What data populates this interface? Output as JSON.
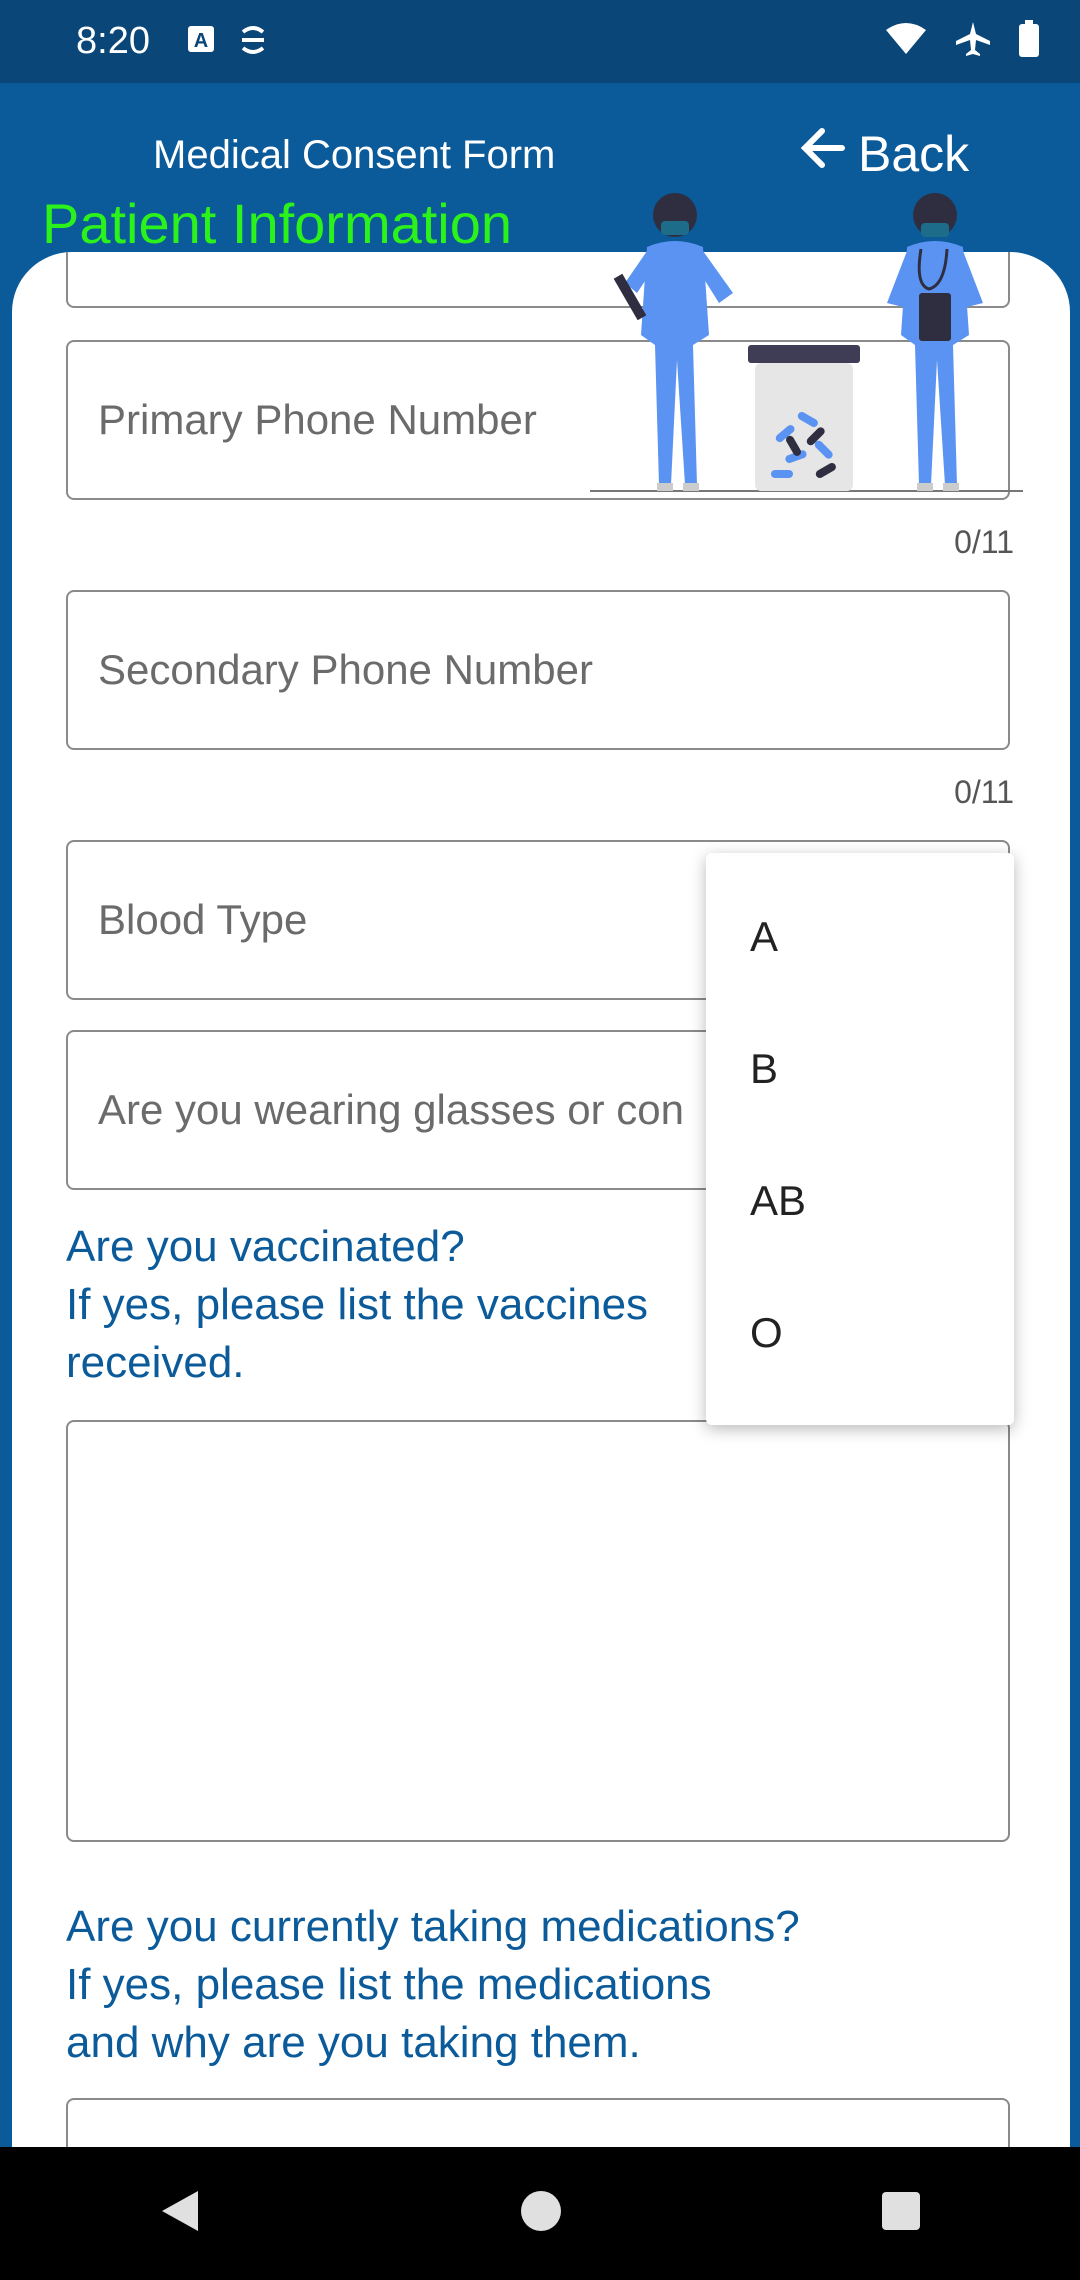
{
  "status_bar": {
    "time": "8:20",
    "left_icons": [
      "text-a-icon",
      "assistant-icon"
    ],
    "right_icons": [
      "wifi-icon",
      "airplane-mode-icon",
      "battery-icon"
    ]
  },
  "header": {
    "title": "Medical Consent Form",
    "back_label": "Back",
    "back_icon": "arrow-left-icon",
    "section_title": "Patient Information"
  },
  "form": {
    "primary_phone": {
      "placeholder": "Primary Phone Number",
      "counter": "0/11"
    },
    "secondary_phone": {
      "placeholder": "Secondary Phone Number",
      "counter": "0/11"
    },
    "blood_type": {
      "placeholder": "Blood Type"
    },
    "glasses": {
      "placeholder": "Are you wearing glasses or con"
    },
    "vaccinated_question": {
      "line1": "Are you vaccinated?",
      "line2": "If yes, please list the vaccines",
      "line3": "received."
    },
    "medications_question": {
      "line1": "Are you currently taking medications?",
      "line2": "If yes, please list the medications",
      "line3": "and why are you taking them."
    }
  },
  "dropdown": {
    "options": [
      "A",
      "B",
      "AB",
      "O"
    ]
  },
  "nav_bar": {
    "icons": [
      "back-triangle-icon",
      "home-circle-icon",
      "recents-square-icon"
    ]
  },
  "colors": {
    "header_bg": "#0b5a9a",
    "status_bg": "#0a4678",
    "section_title": "#2bf21a",
    "question_text": "#0b5a9a",
    "illustration_blue": "#5b93f3"
  }
}
